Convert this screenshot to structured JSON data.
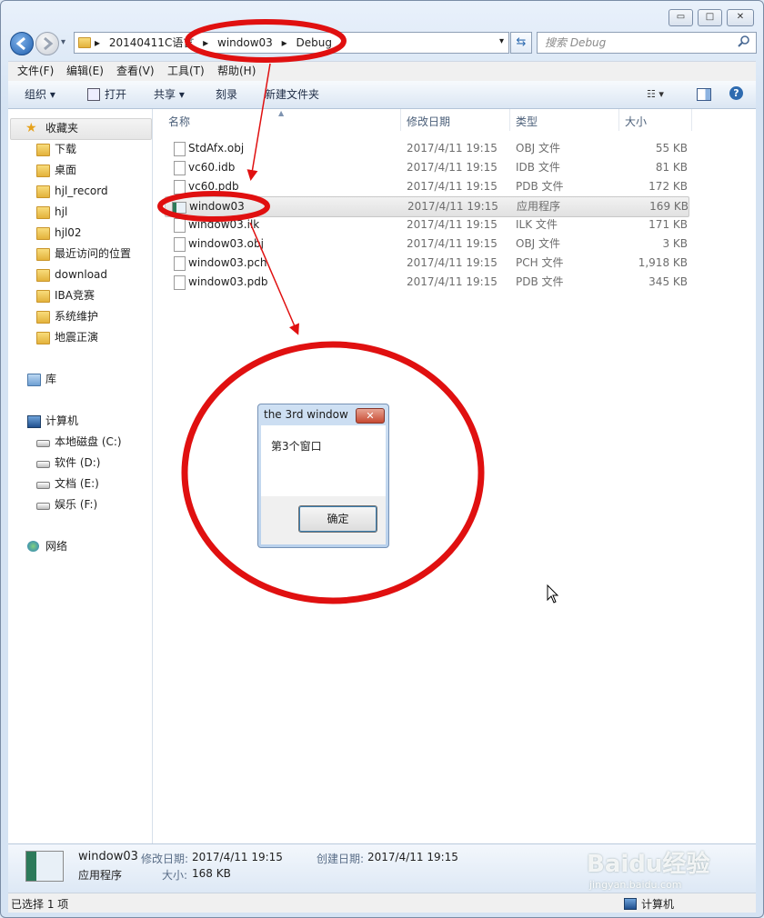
{
  "window": {
    "caption_buttons": {
      "minimize": "▭",
      "maximize": "□",
      "close": "✕"
    }
  },
  "address": {
    "segments": [
      "20140411C语言",
      "window03",
      "Debug"
    ],
    "separator": "▸",
    "dropdown": "▾"
  },
  "search": {
    "placeholder": "搜索 Debug"
  },
  "menu": [
    "文件(F)",
    "编辑(E)",
    "查看(V)",
    "工具(T)",
    "帮助(H)"
  ],
  "commands": {
    "organize": "组织 ▾",
    "open": "打开",
    "share": "共享 ▾",
    "burn": "刻录",
    "new_folder": "新建文件夹"
  },
  "nav": {
    "favorites": "收藏夹",
    "favorite_items": [
      "下载",
      "桌面",
      "hjl_record",
      "hjl",
      "hjl02",
      "最近访问的位置",
      "download",
      "IBA竞赛",
      "系统维护",
      "地震正演"
    ],
    "libraries": "库",
    "computer": "计算机",
    "drives": [
      "本地磁盘 (C:)",
      "软件 (D:)",
      "文档 (E:)",
      "娱乐 (F:)"
    ],
    "network": "网络"
  },
  "columns": {
    "name": "名称",
    "date": "修改日期",
    "type": "类型",
    "size": "大小"
  },
  "files": [
    {
      "name": "StdAfx.obj",
      "date": "2017/4/11 19:15",
      "type": "OBJ 文件",
      "size": "55 KB"
    },
    {
      "name": "vc60.idb",
      "date": "2017/4/11 19:15",
      "type": "IDB 文件",
      "size": "81 KB"
    },
    {
      "name": "vc60.pdb",
      "date": "2017/4/11 19:15",
      "type": "PDB 文件",
      "size": "172 KB"
    },
    {
      "name": "window03",
      "date": "2017/4/11 19:15",
      "type": "应用程序",
      "size": "169 KB"
    },
    {
      "name": "window03.ilk",
      "date": "2017/4/11 19:15",
      "type": "ILK 文件",
      "size": "171 KB"
    },
    {
      "name": "window03.obj",
      "date": "2017/4/11 19:15",
      "type": "OBJ 文件",
      "size": "3 KB"
    },
    {
      "name": "window03.pch",
      "date": "2017/4/11 19:15",
      "type": "PCH 文件",
      "size": "1,918 KB"
    },
    {
      "name": "window03.pdb",
      "date": "2017/4/11 19:15",
      "type": "PDB 文件",
      "size": "345 KB"
    }
  ],
  "dialog": {
    "title": "the 3rd window",
    "close": "✕",
    "message": "第3个窗口",
    "ok": "确定"
  },
  "details": {
    "name": "window03",
    "type": "应用程序",
    "modified_label": "修改日期:",
    "modified": "2017/4/11 19:15",
    "created_label": "创建日期:",
    "created": "2017/4/11 19:15",
    "size_label": "大小:",
    "size": "168 KB"
  },
  "status": {
    "left": "已选择 1 项",
    "right": "计算机"
  },
  "watermark": {
    "brand": "Baidu经验",
    "url": "jingyan.baidu.com"
  },
  "colors": {
    "annotation": "#e01010",
    "accent": "#2e6bb0"
  }
}
